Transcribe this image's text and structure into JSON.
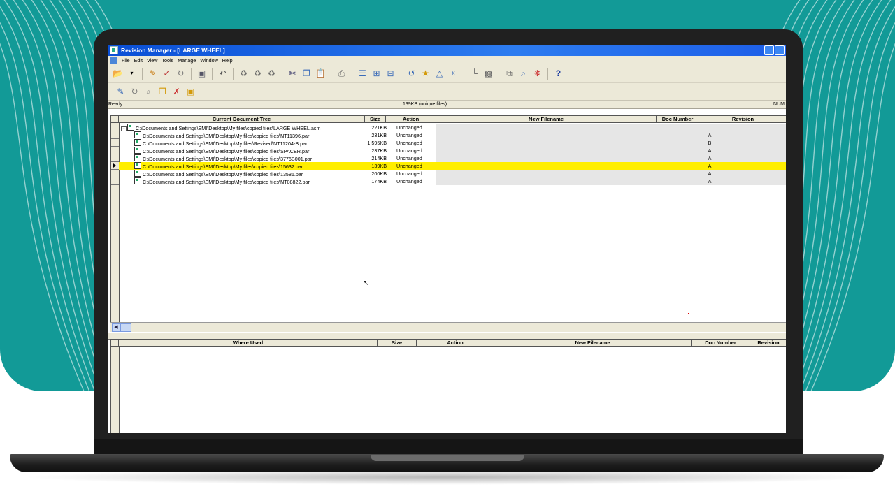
{
  "window": {
    "title": "Revision Manager - [LARGE WHEEL]"
  },
  "menu": [
    "File",
    "Edit",
    "View",
    "Tools",
    "Manage",
    "Window",
    "Help"
  ],
  "status": {
    "left": "Ready",
    "center": "139KB (unique files)",
    "right": "NUM"
  },
  "top_table": {
    "headers": {
      "tree": "Current Document Tree",
      "size": "Size",
      "action": "Action",
      "new_filename": "New Filename",
      "doc_number": "Doc Number",
      "revision": "Revision"
    },
    "rows": [
      {
        "path": "C:\\Documents and Settings\\EMI\\Desktop\\My files\\copied files\\LARGE WHEEL.asm",
        "size": "221KB",
        "action": "Unchanged",
        "revision": "",
        "selected": false,
        "root": true
      },
      {
        "path": "C:\\Documents and Settings\\EMI\\Desktop\\My files\\copied files\\NT11396.par",
        "size": "231KB",
        "action": "Unchanged",
        "revision": "A",
        "selected": false,
        "root": false
      },
      {
        "path": "C:\\Documents and Settings\\EMI\\Desktop\\My files\\Revised\\NT11204-B.par",
        "size": "1,595KB",
        "action": "Unchanged",
        "revision": "B",
        "selected": false,
        "root": false
      },
      {
        "path": "C:\\Documents and Settings\\EMI\\Desktop\\My files\\copied files\\SPACER.par",
        "size": "237KB",
        "action": "Unchanged",
        "revision": "A",
        "selected": false,
        "root": false
      },
      {
        "path": "C:\\Documents and Settings\\EMI\\Desktop\\My files\\copied files\\3776B001.par",
        "size": "214KB",
        "action": "Unchanged",
        "revision": "A",
        "selected": false,
        "root": false
      },
      {
        "path": "C:\\Documents and Settings\\EMI\\Desktop\\My files\\copied files\\15632.par",
        "size": "139KB",
        "action": "Unchanged",
        "revision": "A",
        "selected": true,
        "root": false
      },
      {
        "path": "C:\\Documents and Settings\\EMI\\Desktop\\My files\\copied files\\13586.par",
        "size": "200KB",
        "action": "Unchanged",
        "revision": "A",
        "selected": false,
        "root": false
      },
      {
        "path": "C:\\Documents and Settings\\EMI\\Desktop\\My files\\copied files\\NT08822.par",
        "size": "174KB",
        "action": "Unchanged",
        "revision": "A",
        "selected": false,
        "root": false
      }
    ]
  },
  "bottom_table": {
    "headers": {
      "where_used": "Where Used",
      "size": "Size",
      "action": "Action",
      "new_filename": "New Filename",
      "doc_number": "Doc Number",
      "revision": "Revision"
    }
  },
  "icons": {
    "toolbar1": [
      "open-icon",
      "dropdown-icon",
      "edit-properties-icon",
      "revise-icon",
      "refresh-icon",
      "save-icon",
      "undo-icon",
      "replace-icon",
      "replace-all-icon",
      "rename-icon",
      "cut-icon",
      "copy-icon",
      "paste-icon",
      "print-icon",
      "tree-icon",
      "expand-tree-icon",
      "collapse-tree-icon",
      "link-icon",
      "release-icon",
      "obsolete-icon",
      "assign-icon",
      "move-up-icon",
      "move-down-icon",
      "duplicate-icon",
      "find-icon",
      "settings-icon",
      "help-icon"
    ],
    "toolbar2": [
      "new-document-icon",
      "revise-document-icon",
      "find-document-icon",
      "rename-document-icon",
      "delete-document-icon",
      "properties-document-icon"
    ]
  },
  "colors": {
    "accent_background": "#129a97",
    "selected_row": "#ffee00",
    "titlebar": "#0a4fd6"
  }
}
